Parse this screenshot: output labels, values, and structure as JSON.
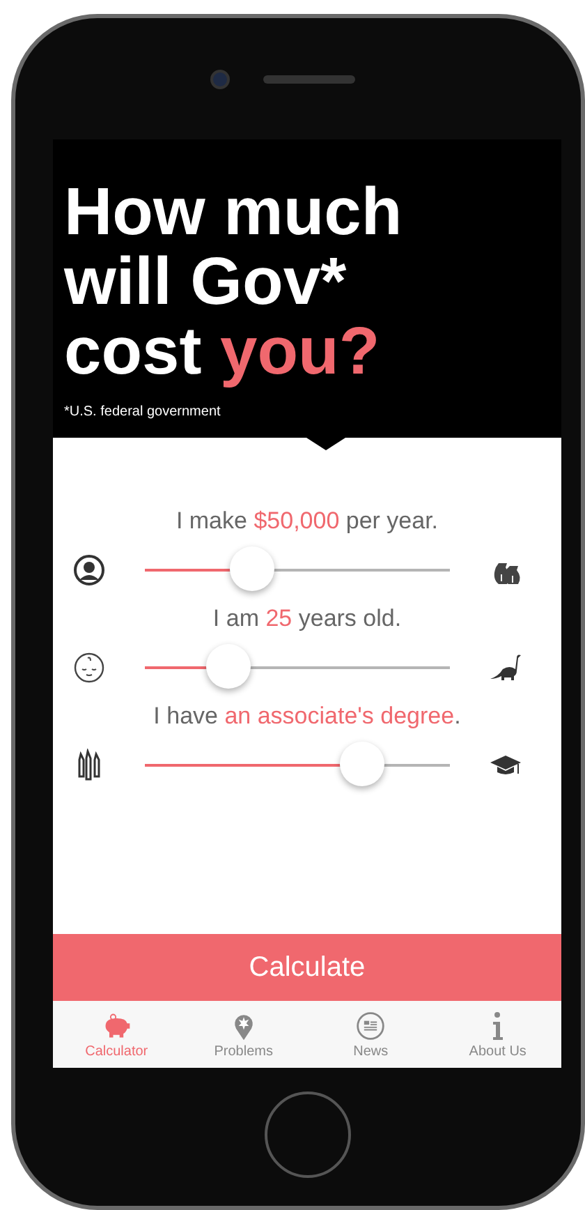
{
  "headline": {
    "text": "How much will Gov* cost",
    "highlight": "you?"
  },
  "footnote": "*U.S. federal government",
  "sliders": [
    {
      "prefix": "I make ",
      "value": "$50,000",
      "suffix": " per year.",
      "level": 0.28
    },
    {
      "prefix": "I am ",
      "value": "25",
      "suffix": " years old.",
      "level": 0.2
    },
    {
      "prefix": "I have ",
      "value": "an associate's degree",
      "suffix": ".",
      "level": 0.64
    }
  ],
  "action_button": "Calculate",
  "tabs": [
    {
      "label": "Calculator",
      "selected": true
    },
    {
      "label": "Problems",
      "selected": false
    },
    {
      "label": "News",
      "selected": false
    },
    {
      "label": "About Us",
      "selected": false
    }
  ]
}
